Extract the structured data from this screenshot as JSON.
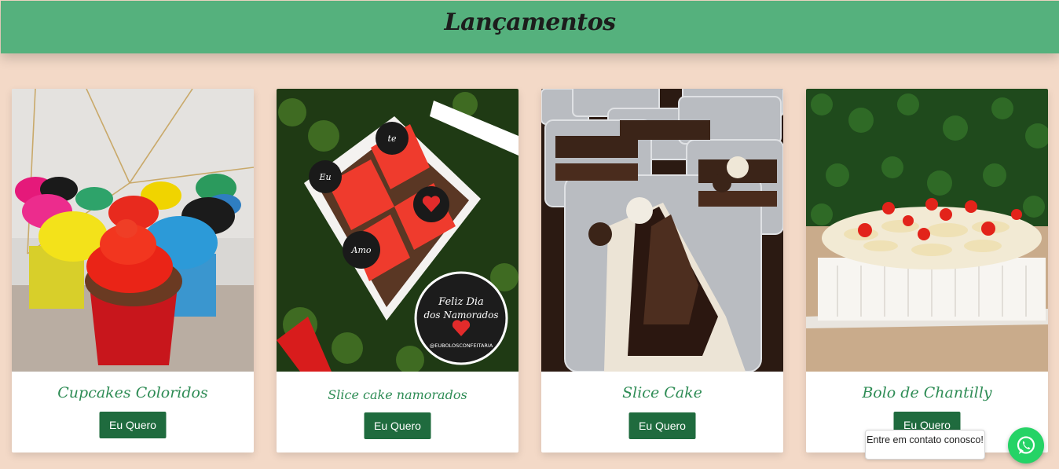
{
  "header": {
    "title": "Lançamentos"
  },
  "products": [
    {
      "title": "Cupcakes Coloridos",
      "button": "Eu Quero"
    },
    {
      "title": "Slice cake namorados",
      "button": "Eu Quero"
    },
    {
      "title": "Slice Cake",
      "button": "Eu Quero"
    },
    {
      "title": "Bolo de Chantilly",
      "button": "Eu Quero"
    }
  ],
  "photo_labels": {
    "namorados_box": [
      "Eu",
      "te",
      "Amo"
    ],
    "namorados_tag": [
      "Feliz Dia",
      "dos Namorados"
    ],
    "namorados_handle": "@EUBOLOSCONFEITARIA"
  },
  "whatsapp": {
    "bubble_text": "Entre em contato conosco!",
    "icon": "whatsapp-icon"
  },
  "colors": {
    "header": "#55b17d",
    "button": "#1f6b3e",
    "title": "#2e8c55",
    "background": "#f3d9c7"
  }
}
